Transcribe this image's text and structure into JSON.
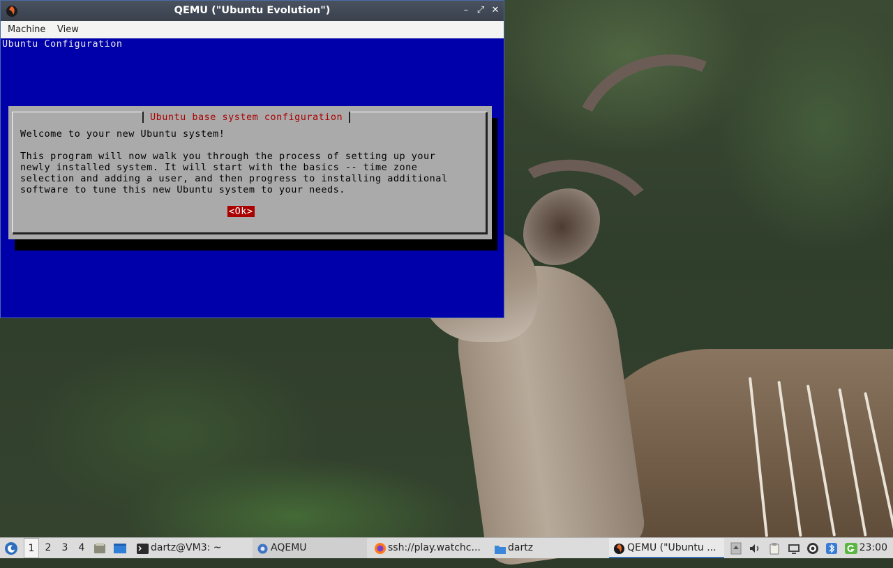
{
  "window": {
    "title": "QEMU (\"Ubuntu Evolution\")",
    "minimize": "–",
    "maximize": "⤢",
    "close": "✕",
    "menu": [
      "Machine",
      "View"
    ]
  },
  "console": {
    "header": "Ubuntu Configuration",
    "dialog": {
      "title": "Ubuntu base system configuration",
      "welcome": "Welcome to your new Ubuntu system!",
      "body": [
        "This program will now walk you through the process of setting up your",
        "newly installed system. It will start with the basics -- time zone",
        "selection and adding a user, and then progress to installing additional",
        "software to tune this new Ubuntu system to your needs."
      ],
      "ok_label": "<Ok>"
    }
  },
  "taskbar": {
    "workspaces": [
      "1",
      "2",
      "3",
      "4"
    ],
    "tasks": [
      {
        "label": "dartz@VM3: ~",
        "icon": "terminal-icon"
      },
      {
        "label": "AQEMU",
        "icon": "aqemu-icon"
      },
      {
        "label": "ssh://play.watchc...",
        "icon": "firefox-icon"
      },
      {
        "label": "dartz",
        "icon": "folder-icon"
      },
      {
        "label": "QEMU (\"Ubuntu ...",
        "icon": "qemu-icon"
      }
    ],
    "clock": "23:00",
    "colors": {
      "accent": "#3a6fb5",
      "console_bg": "#0000aa",
      "dialog_bg": "#aaaaaa",
      "dialog_title": "#aa0000"
    }
  }
}
